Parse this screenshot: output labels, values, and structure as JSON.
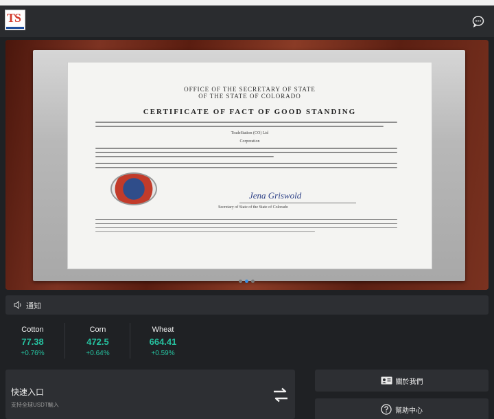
{
  "header": {
    "logo_text": "TS",
    "chat_icon": "chat-bubble-icon"
  },
  "banner": {
    "certificate": {
      "office_line1": "OFFICE OF THE SECRETARY OF STATE",
      "office_line2": "OF THE STATE OF COLORADO",
      "title": "CERTIFICATE OF FACT OF GOOD STANDING",
      "entity": "TradeStation (CO) Ltd",
      "kind": "Corporation",
      "signature": "Jena Griswold",
      "signature_caption": "Secretary of State of the State of Colorado"
    },
    "slides_total": 3,
    "active_slide": 2
  },
  "notice": {
    "icon": "speaker-icon",
    "label": "通知"
  },
  "prices": [
    {
      "name": "Cotton",
      "value": "77.38",
      "change": "+0.76%"
    },
    {
      "name": "Corn",
      "value": "472.5",
      "change": "+0.64%"
    },
    {
      "name": "Wheat",
      "value": "664.41",
      "change": "+0.59%"
    }
  ],
  "quick_entry": {
    "title": "快速入口",
    "subtitle": "支持全球USDT輸入",
    "icon": "swap-arrows-icon"
  },
  "about_button": {
    "label": "關於我們",
    "icon": "id-card-icon"
  },
  "help_button": {
    "label": "幫助中心",
    "icon": "question-circle-icon"
  },
  "colors": {
    "accent_green": "#26c2a0",
    "background": "#1f2124",
    "panel": "#2d2f33"
  }
}
